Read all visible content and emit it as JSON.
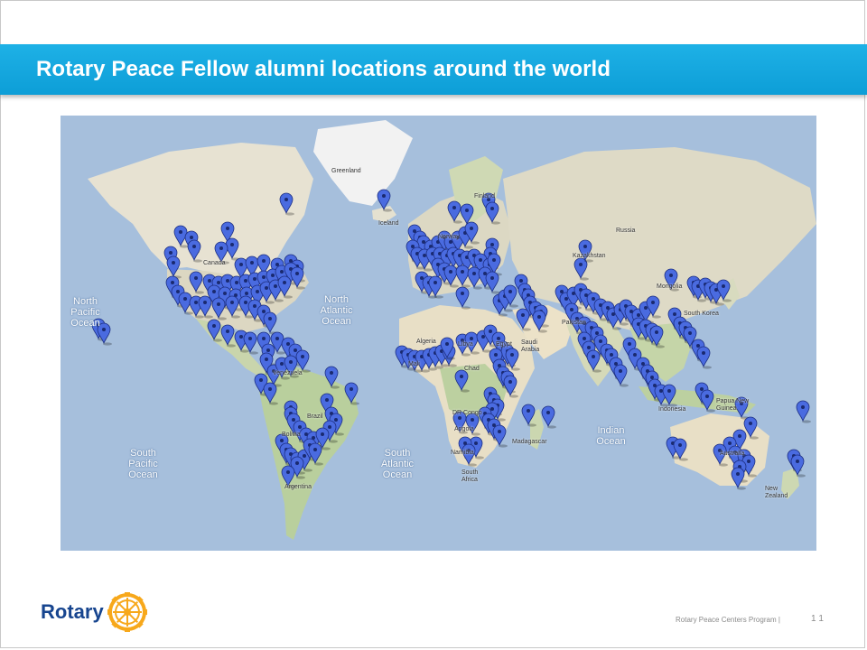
{
  "slide": {
    "title": "Rotary Peace Fellow alumni locations around the world"
  },
  "map": {
    "ocean_color": "#a6bfdc",
    "land_color": "#e2ddcb",
    "vegetation_color": "#b8cfa0",
    "ice_color": "#f4f4f4",
    "marker_color": "#4a6be0",
    "ocean_labels": {
      "north_pacific": "North\nPacific\nOcean",
      "north_atlantic": "North\nAtlantic\nOcean",
      "south_pacific": "South\nPacific\nOcean",
      "south_atlantic": "South\nAtlantic\nOcean",
      "indian": "Indian\nOcean"
    },
    "land_labels": {
      "greenland": "Greenland",
      "iceland": "Iceland",
      "canada": "Canada",
      "russia": "Russia",
      "kazakhstan": "Kazakhstan",
      "mongolia": "Mongolia",
      "finland": "Finland",
      "norway": "Norway",
      "algeria": "Algeria",
      "libya": "Libya",
      "egypt": "Egypt",
      "mali": "Mali",
      "chad": "Chad",
      "congo": "DR Congo",
      "namibia": "Namibia",
      "south_africa": "South\nAfrica",
      "madagascar": "Madagascar",
      "angola": "Angola",
      "arabia": "Saudi\nArabia",
      "afghanistan": "Afghanistan",
      "pakistan": "Pakistan",
      "south_korea": "South Korea",
      "indonesia": "Indonesia",
      "papua": "Papua New\nGuinea",
      "australia": "Australia",
      "new_zealand": "New\nZealand",
      "venezuela": "Venezuela",
      "brazil": "Brazil",
      "bolivia": "Bolivia",
      "argentina": "Argentina",
      "chile": "Chile"
    }
  },
  "footer": {
    "brand": "Rotary",
    "program": "Rotary Peace Centers Program",
    "separator": "|",
    "page_number": "1 1"
  }
}
